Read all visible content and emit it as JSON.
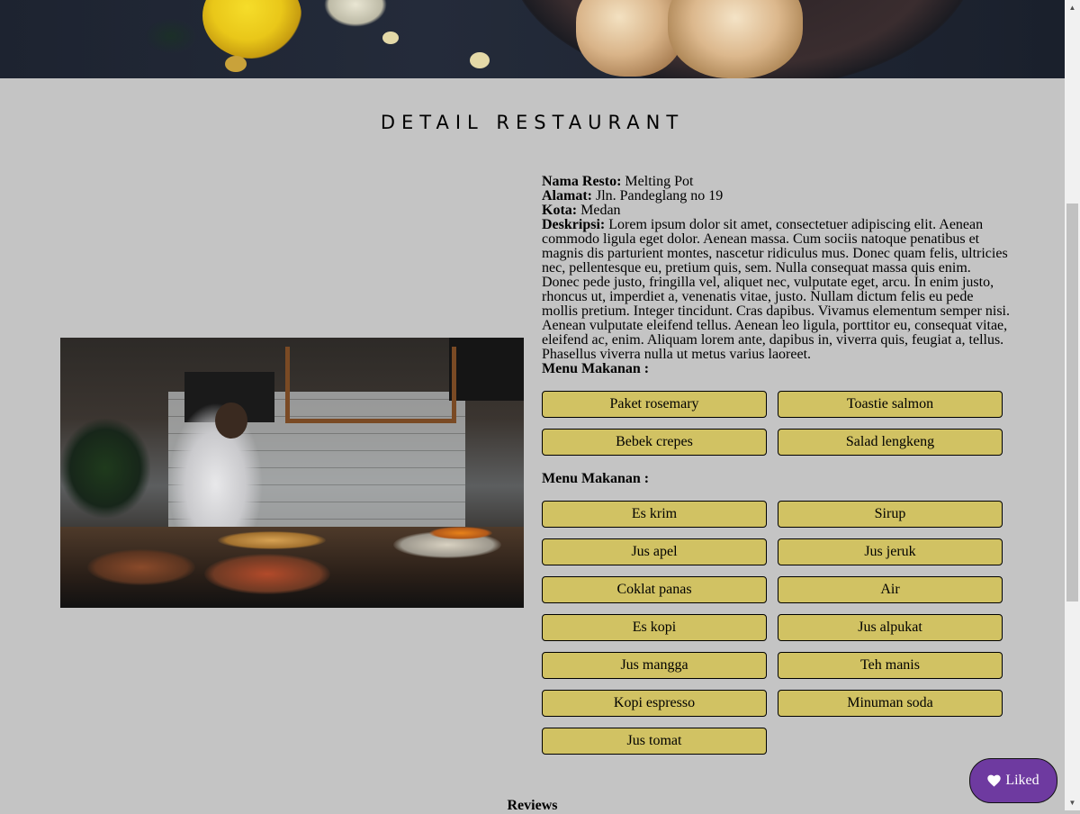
{
  "page": {
    "section_title": "DETAIL RESTAURANT",
    "reviews_title": "Reviews"
  },
  "restaurant": {
    "name_label": "Nama Resto:",
    "name": "Melting Pot",
    "address_label": "Alamat:",
    "address": "Jln. Pandeglang no 19",
    "city_label": "Kota:",
    "city": "Medan",
    "description_label": "Deskripsi:",
    "description": "Lorem ipsum dolor sit amet, consectetuer adipiscing elit. Aenean commodo ligula eget dolor. Aenean massa. Cum sociis natoque penatibus et magnis dis parturient montes, nascetur ridiculus mus. Donec quam felis, ultricies nec, pellentesque eu, pretium quis, sem. Nulla consequat massa quis enim. Donec pede justo, fringilla vel, aliquet nec, vulputate eget, arcu. In enim justo, rhoncus ut, imperdiet a, venenatis vitae, justo. Nullam dictum felis eu pede mollis pretium. Integer tincidunt. Cras dapibus. Vivamus elementum semper nisi. Aenean vulputate eleifend tellus. Aenean leo ligula, porttitor eu, consequat vitae, eleifend ac, enim. Aliquam lorem ante, dapibus in, viverra quis, feugiat a, tellus. Phasellus viverra nulla ut metus varius laoreet."
  },
  "menus": {
    "foods_heading": "Menu Makanan :",
    "foods": [
      "Paket rosemary",
      "Toastie salmon",
      "Bebek crepes",
      "Salad lengkeng"
    ],
    "drinks_heading": "Menu Makanan :",
    "drinks": [
      "Es krim",
      "Sirup",
      "Jus apel",
      "Jus jeruk",
      "Coklat panas",
      "Air",
      "Es kopi",
      "Jus alpukat",
      "Jus mangga",
      "Teh manis",
      "Kopi espresso",
      "Minuman soda",
      "Jus tomat"
    ]
  },
  "like_button": {
    "label": "Liked",
    "icon": "heart-icon",
    "color": "#6e3aa0"
  },
  "colors": {
    "background": "#c4c4c4",
    "menu_button": "#d1c263"
  }
}
